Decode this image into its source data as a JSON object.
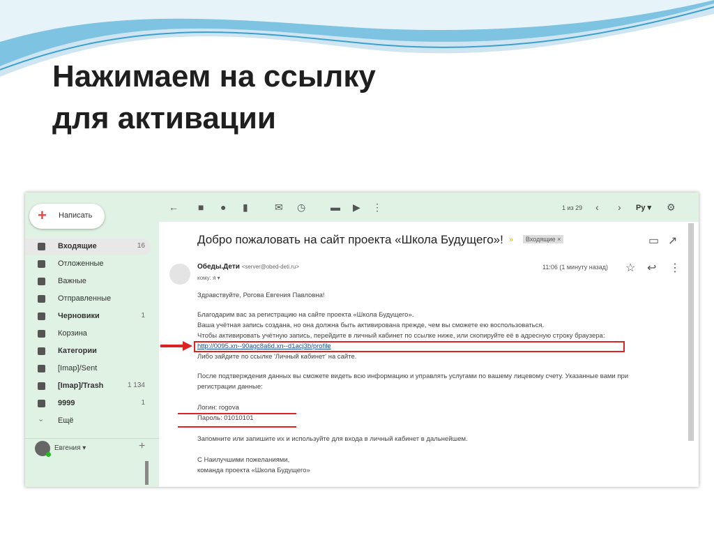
{
  "slide": {
    "title_line1": "Нажимаем на ссылку",
    "title_line2": "для активации"
  },
  "sidebar": {
    "compose": "Написать",
    "items": [
      {
        "label": "Входящие",
        "count": "16",
        "bold": true
      },
      {
        "label": "Отложенные",
        "count": ""
      },
      {
        "label": "Важные",
        "count": ""
      },
      {
        "label": "Отправленные",
        "count": ""
      },
      {
        "label": "Черновики",
        "count": "1",
        "bold": true
      },
      {
        "label": "Корзина",
        "count": ""
      },
      {
        "label": "Категории",
        "count": "",
        "bold": true
      },
      {
        "label": "[Imap]/Sent",
        "count": ""
      },
      {
        "label": "[Imap]/Trash",
        "count": "1 134",
        "bold": true
      },
      {
        "label": "9999",
        "count": "1",
        "bold": true
      },
      {
        "label": "Ещё",
        "count": ""
      }
    ],
    "user": "Евгения ▾"
  },
  "toolbar": {
    "pager": "1 из 29",
    "lang": "Ру ▾"
  },
  "email": {
    "subject": "Добро пожаловать на сайт проекта «Школа Будущего»!",
    "label": "Входящие ×",
    "sender_name": "Обеды.Дети",
    "sender_email": "<server@obed-deti.ru>",
    "to": "кому: я ▾",
    "time": "11:06 (1 минуту назад)",
    "body": [
      "Здравствуйте, Рогова Евгения Павловна!",
      "Благодарим вас за регистрацию на сайте проекта «Школа Будущего».",
      "Ваша учётная запись создана, но она должна быть активирована прежде, чем вы сможете ею воспользоваться.",
      "Чтобы активировать учётную запись, перейдите в личный кабинет по ссылке ниже, или скопируйте её в адресную строку браузера:",
      "http://0095.xn--90agc8a6d.xn--d1acj3b/profile",
      "Либо зайдите по ссылке 'Личный кабинет' на сайте.",
      "После подтверждения данных вы сможете видеть всю информацию и управлять услугами по вашему лицевому счету. Указанные вами при",
      "регистрации данные:",
      "Логин: rogova",
      "Пароль: 01010101",
      "Запомните или запишите их и используйте для входа в личный кабинет в дальнейшем.",
      "С Наилучшими пожеланиями,",
      "команда проекта «Школа Будущего»"
    ]
  },
  "colors": {
    "sidebar": "#dff2e3",
    "highlight": "#d22222",
    "link": "#1a4fa0"
  }
}
